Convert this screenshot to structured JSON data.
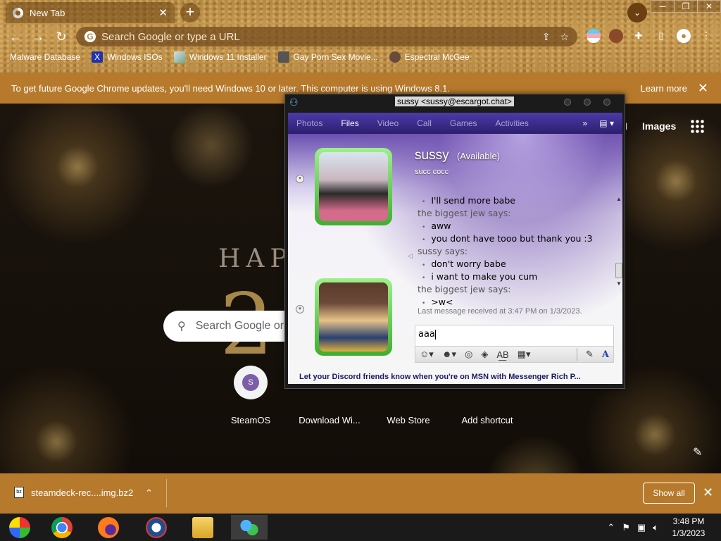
{
  "tab": {
    "title": "New Tab"
  },
  "omnibox": {
    "placeholder": "Search Google or type a URL"
  },
  "bookmarks": [
    {
      "label": "Malware Database"
    },
    {
      "label": "Windows ISOs"
    },
    {
      "label": "Windows 11 Installer"
    },
    {
      "label": "Gay Porn Sex Movie..."
    },
    {
      "label": "Espectral McGee"
    }
  ],
  "update_bar": {
    "text": "To get future Google Chrome updates, you'll need Windows 10 or later. This computer is using Windows 8.1.",
    "learn_more": "Learn more"
  },
  "ntp": {
    "gmail": "ail",
    "images": "Images",
    "doodle_text": "HAP",
    "doodle_digit": "2",
    "search_placeholder": "Search Google or",
    "shortcuts": [
      {
        "label": "SteamOS",
        "initial": "S"
      },
      {
        "label": "Download Wi..."
      },
      {
        "label": "Web Store"
      },
      {
        "label": "Add shortcut"
      }
    ]
  },
  "download_bar": {
    "file": "steamdeck-rec....img.bz2",
    "file_icon_text": "bz",
    "show_all": "Show all"
  },
  "taskbar": {
    "time": "3:48 PM",
    "date": "1/3/2023"
  },
  "messenger": {
    "title": "sussy <sussy@escargot.chat>",
    "menu": [
      "Photos",
      "Files",
      "Video",
      "Call",
      "Games",
      "Activities"
    ],
    "active_menu": "Files",
    "contact_name": "sussy",
    "contact_status": "(Available)",
    "contact_psm": "succ cocc",
    "history": [
      {
        "type": "msg",
        "text": "I'll send more babe"
      },
      {
        "type": "says",
        "text": "the biggest jew says:"
      },
      {
        "type": "msg",
        "text": "aww"
      },
      {
        "type": "msg",
        "text": "you dont have tooo but thank you :3"
      },
      {
        "type": "says",
        "text": "sussy says:"
      },
      {
        "type": "msg",
        "text": "don't worry babe"
      },
      {
        "type": "msg",
        "text": "i want to make you cum"
      },
      {
        "type": "says",
        "text": "the biggest jew says:"
      },
      {
        "type": "msg",
        "text": ">w<"
      }
    ],
    "last_message": "Last message received at 3:47 PM on 1/3/2023.",
    "input_value": "aaa",
    "ad_text": "Let your Discord friends know when you're on MSN with Messenger Rich P..."
  }
}
